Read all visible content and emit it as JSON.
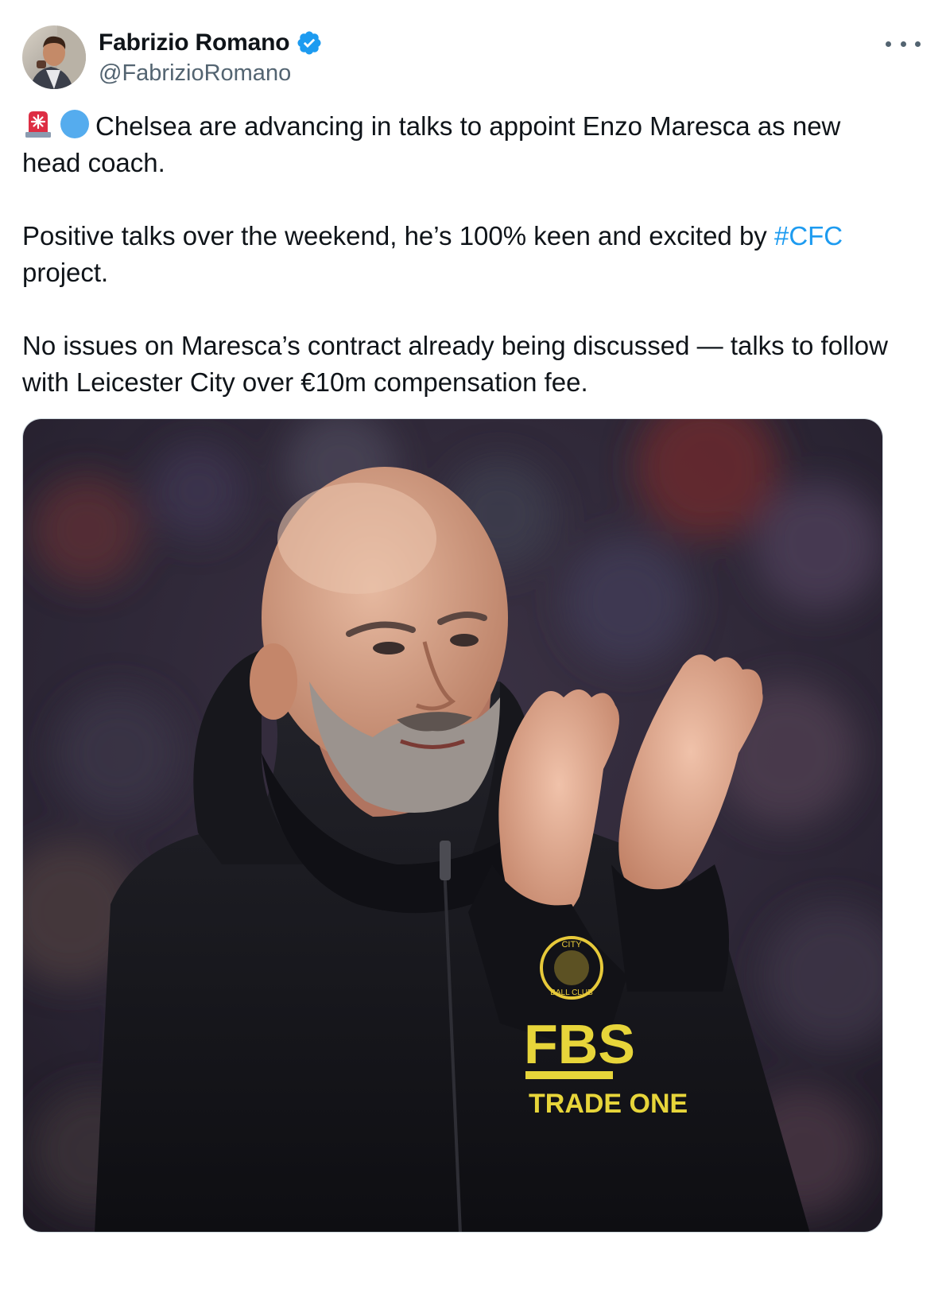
{
  "author": {
    "display_name": "Fabrizio Romano",
    "handle": "@FabrizioRomano",
    "verified": true,
    "avatar_icon": "avatar-photo"
  },
  "menu": {
    "icon": "more-horizontal-icon"
  },
  "tweet": {
    "emojis": [
      "police-light-emoji",
      "blue-circle-emoji"
    ],
    "paragraph_1": "Chelsea are advancing in talks to appoint Enzo Maresca as new head coach.",
    "paragraph_2_before": "Positive talks over the weekend, he’s 100% keen and excited by ",
    "paragraph_2_hashtag": "#CFC",
    "paragraph_2_after": " project.",
    "paragraph_3": "No issues on Maresca’s contract already being discussed — talks to follow with Leicester City over €10m compensation fee."
  },
  "media": {
    "jacket_text_line1": "FBS",
    "jacket_text_line2": "TRADE ONE",
    "badge_text_top": "CITY",
    "badge_text_bottom": "BALL CLUB"
  },
  "colors": {
    "text": "#0f1419",
    "secondary": "#536471",
    "link": "#1d9bf0",
    "verified": "#1d9bf0"
  }
}
